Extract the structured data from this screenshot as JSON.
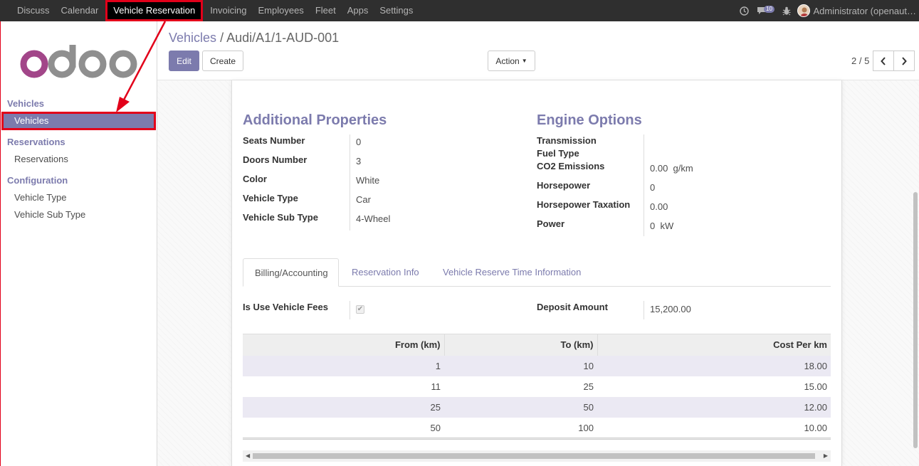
{
  "topbar": {
    "menu": [
      "Discuss",
      "Calendar",
      "Vehicle Reservation",
      "Invoicing",
      "Employees",
      "Fleet",
      "Apps",
      "Settings"
    ],
    "active_index": 2,
    "messages_count": "10",
    "user": "Administrator (openaut…"
  },
  "sidebar": {
    "logo_text": "odoo",
    "sections": [
      {
        "title": "Vehicles",
        "items": [
          "Vehicles"
        ]
      },
      {
        "title": "Reservations",
        "items": [
          "Reservations"
        ]
      },
      {
        "title": "Configuration",
        "items": [
          "Vehicle Type",
          "Vehicle Sub Type"
        ]
      }
    ]
  },
  "control": {
    "breadcrumb_parent": "Vehicles",
    "breadcrumb_sep": "/",
    "breadcrumb_current": "Audi/A1/1-AUD-001",
    "edit_label": "Edit",
    "create_label": "Create",
    "action_label": "Action",
    "pager": "2 / 5"
  },
  "form": {
    "additional_title": "Additional Properties",
    "engine_title": "Engine Options",
    "additional": [
      {
        "label": "Seats Number",
        "value": "0"
      },
      {
        "label": "Doors Number",
        "value": "3"
      },
      {
        "label": "Color",
        "value": "White"
      },
      {
        "label": "Vehicle Type",
        "value": "Car"
      },
      {
        "label": "Vehicle Sub Type",
        "value": "4-Wheel"
      }
    ],
    "engine": [
      {
        "label": "Transmission",
        "value": ""
      },
      {
        "label": "Fuel Type",
        "value": ""
      },
      {
        "label": "CO2 Emissions",
        "value": "0.00  g/km"
      },
      {
        "label": "Horsepower",
        "value": "0"
      },
      {
        "label": "Horsepower Taxation",
        "value": "0.00"
      },
      {
        "label": "Power",
        "value": "0  kW"
      }
    ],
    "tabs": [
      "Billing/Accounting",
      "Reservation Info",
      "Vehicle Reserve Time Information"
    ],
    "use_fees_label": "Is Use Vehicle Fees",
    "use_fees_checked": true,
    "deposit_label": "Deposit Amount",
    "deposit_value": "15,200.00",
    "table": {
      "headers": [
        "From (km)",
        "To (km)",
        "Cost Per km"
      ],
      "rows": [
        [
          "1",
          "10",
          "18.00"
        ],
        [
          "11",
          "25",
          "15.00"
        ],
        [
          "25",
          "50",
          "12.00"
        ],
        [
          "50",
          "100",
          "10.00"
        ]
      ]
    }
  }
}
